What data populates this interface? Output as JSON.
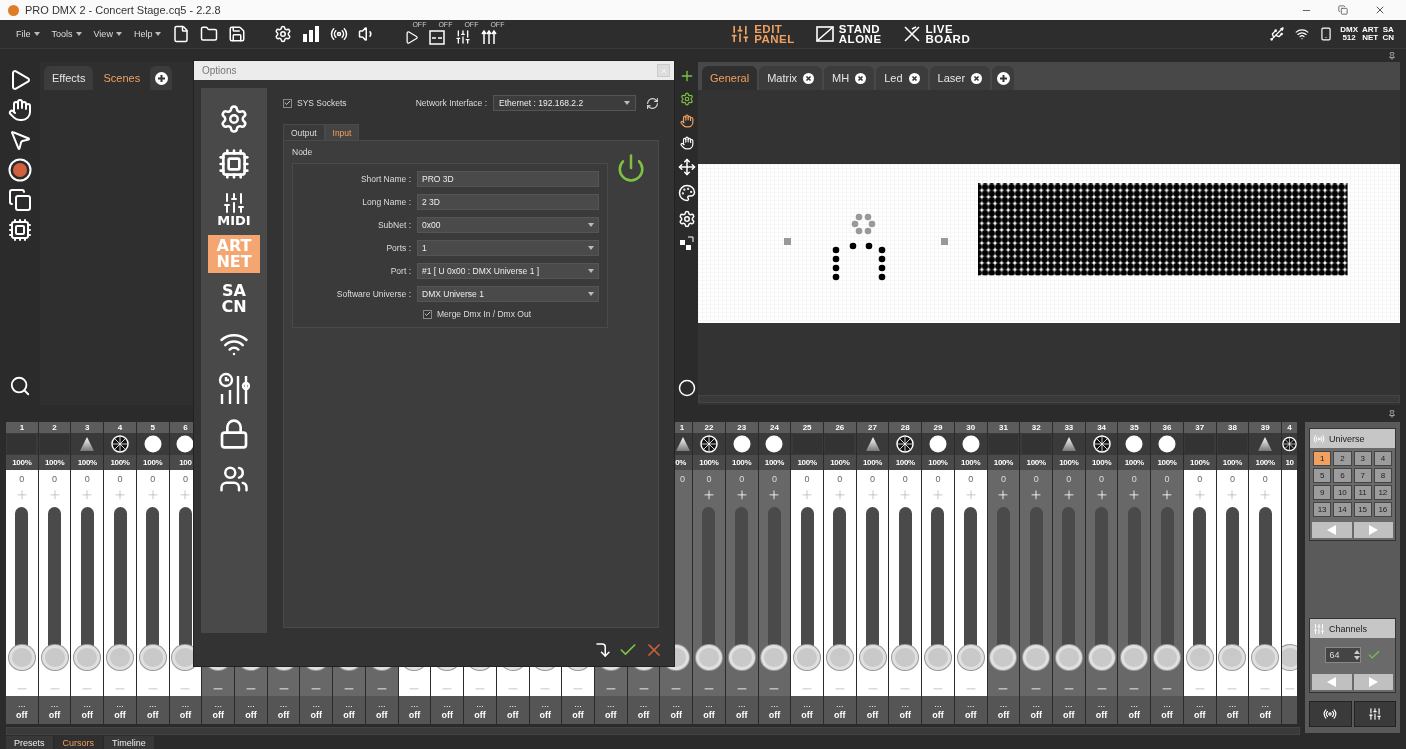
{
  "window": {
    "title": "PRO DMX 2 - Concert Stage.cq5 - 2.2.8"
  },
  "menu": [
    {
      "label": "File"
    },
    {
      "label": "Tools"
    },
    {
      "label": "View"
    },
    {
      "label": "Help"
    }
  ],
  "toolbar_toggles": [
    {
      "label": "OFF"
    },
    {
      "label": "OFF"
    },
    {
      "label": "OFF"
    },
    {
      "label": "OFF"
    }
  ],
  "modes": [
    {
      "label": "EDIT PANEL",
      "selected": true
    },
    {
      "label": "STAND ALONE",
      "selected": false
    },
    {
      "label": "LIVE BOARD",
      "selected": false
    }
  ],
  "protocols": [
    "DMX 512",
    "ART NET",
    "SA CN"
  ],
  "left_panel": {
    "tabs": [
      {
        "label": "Effects",
        "selected": false
      },
      {
        "label": "Scenes",
        "selected": true
      }
    ]
  },
  "stage": {
    "tabs": [
      {
        "label": "General",
        "selected": true,
        "closable": false
      },
      {
        "label": "Matrix",
        "selected": false,
        "closable": true
      },
      {
        "label": "MH",
        "selected": false,
        "closable": true
      },
      {
        "label": "Led",
        "selected": false,
        "closable": true
      },
      {
        "label": "Laser",
        "selected": false,
        "closable": true
      }
    ]
  },
  "channels": [
    {
      "number": "1",
      "kind": "blank",
      "percent": "100%",
      "value": "0",
      "dots": "...",
      "state": "off",
      "color": "#ffffff"
    },
    {
      "number": "2",
      "kind": "blank",
      "percent": "100%",
      "value": "0",
      "dots": "...",
      "state": "off",
      "color": "#ffffff"
    },
    {
      "number": "3",
      "kind": "beam",
      "percent": "100%",
      "value": "0",
      "dots": "...",
      "state": "off",
      "color": "#ffffff"
    },
    {
      "number": "4",
      "kind": "gobo",
      "percent": "100%",
      "value": "0",
      "dots": "...",
      "state": "off",
      "color": "#ffffff"
    },
    {
      "number": "5",
      "kind": "dot",
      "percent": "100%",
      "value": "0",
      "dots": "...",
      "state": "off",
      "color": "#ffffff"
    },
    {
      "number": "6",
      "kind": "dot",
      "percent": "100",
      "value": "0",
      "dots": "...",
      "state": "off",
      "color": "#ffffff"
    },
    {
      "dots": "...",
      "state": "off",
      "color": "#686868"
    },
    {
      "dots": "...",
      "state": "off",
      "color": "#686868"
    },
    {
      "dots": "...",
      "state": "off",
      "color": "#686868"
    },
    {
      "dots": "...",
      "state": "off",
      "color": "#686868"
    },
    {
      "dots": "...",
      "state": "off",
      "color": "#686868"
    },
    {
      "dots": "...",
      "state": "off",
      "color": "#686868"
    },
    {
      "dots": "...",
      "state": "off",
      "color": "#ffffff"
    },
    {
      "dots": "...",
      "state": "off",
      "color": "#ffffff"
    },
    {
      "dots": "...",
      "state": "off",
      "color": "#ffffff"
    },
    {
      "dots": "...",
      "state": "off",
      "color": "#ffffff"
    },
    {
      "dots": "...",
      "state": "off",
      "color": "#ffffff"
    },
    {
      "dots": "...",
      "state": "off",
      "color": "#ffffff"
    },
    {
      "dots": "...",
      "state": "off",
      "color": "#686868"
    },
    {
      "dots": "...",
      "state": "off",
      "color": "#686868"
    },
    {
      "number": "1",
      "kind": "beam",
      "percent": "0%",
      "value": "0",
      "dots": "...",
      "state": "off",
      "color": "#686868"
    },
    {
      "number": "22",
      "kind": "gobo",
      "percent": "100%",
      "value": "0",
      "dots": "...",
      "state": "off",
      "color": "#686868"
    },
    {
      "number": "23",
      "kind": "dot",
      "percent": "100%",
      "value": "0",
      "dots": "...",
      "state": "off",
      "color": "#686868"
    },
    {
      "number": "24",
      "kind": "dot",
      "percent": "100%",
      "value": "0",
      "dots": "...",
      "state": "off",
      "color": "#686868"
    },
    {
      "number": "25",
      "kind": "blank",
      "percent": "100%",
      "value": "0",
      "dots": "...",
      "state": "off",
      "color": "#ffffff"
    },
    {
      "number": "26",
      "kind": "blank",
      "percent": "100%",
      "value": "0",
      "dots": "...",
      "state": "off",
      "color": "#ffffff"
    },
    {
      "number": "27",
      "kind": "beam",
      "percent": "100%",
      "value": "0",
      "dots": "...",
      "state": "off",
      "color": "#ffffff"
    },
    {
      "number": "28",
      "kind": "gobo",
      "percent": "100%",
      "value": "0",
      "dots": "...",
      "state": "off",
      "color": "#ffffff"
    },
    {
      "number": "29",
      "kind": "dot",
      "percent": "100%",
      "value": "0",
      "dots": "...",
      "state": "off",
      "color": "#ffffff"
    },
    {
      "number": "30",
      "kind": "dot",
      "percent": "100%",
      "value": "0",
      "dots": "...",
      "state": "off",
      "color": "#ffffff"
    },
    {
      "number": "31",
      "kind": "blank",
      "percent": "100%",
      "value": "0",
      "dots": "...",
      "state": "off",
      "color": "#686868"
    },
    {
      "number": "32",
      "kind": "blank",
      "percent": "100%",
      "value": "0",
      "dots": "...",
      "state": "off",
      "color": "#686868"
    },
    {
      "number": "33",
      "kind": "beam",
      "percent": "100%",
      "value": "0",
      "dots": "...",
      "state": "off",
      "color": "#686868"
    },
    {
      "number": "34",
      "kind": "gobo",
      "percent": "100%",
      "value": "0",
      "dots": "...",
      "state": "off",
      "color": "#686868"
    },
    {
      "number": "35",
      "kind": "dot",
      "percent": "100%",
      "value": "0",
      "dots": "...",
      "state": "off",
      "color": "#686868"
    },
    {
      "number": "36",
      "kind": "dot",
      "percent": "100%",
      "value": "0",
      "dots": "...",
      "state": "off",
      "color": "#686868"
    },
    {
      "number": "37",
      "kind": "blank",
      "percent": "100%",
      "value": "0",
      "dots": "...",
      "state": "off",
      "color": "#ffffff"
    },
    {
      "number": "38",
      "kind": "blank",
      "percent": "100%",
      "value": "0",
      "dots": "...",
      "state": "off",
      "color": "#ffffff"
    },
    {
      "number": "39",
      "kind": "beam",
      "percent": "100%",
      "value": "0",
      "dots": "...",
      "state": "off",
      "color": "#ffffff"
    },
    {
      "number": "4",
      "kind": "gobo",
      "percent": "10",
      "color": "#ffffff"
    }
  ],
  "universe_panel": {
    "title": "Universe",
    "universes": [
      {
        "label": "1",
        "selected": true
      },
      {
        "label": "2",
        "selected": false
      },
      {
        "label": "3",
        "selected": false
      },
      {
        "label": "4",
        "selected": false
      },
      {
        "label": "5",
        "selected": false
      },
      {
        "label": "6",
        "selected": false
      },
      {
        "label": "7",
        "selected": false
      },
      {
        "label": "8",
        "selected": false
      },
      {
        "label": "9",
        "selected": false
      },
      {
        "label": "10",
        "selected": false
      },
      {
        "label": "11",
        "selected": false
      },
      {
        "label": "12",
        "selected": false
      },
      {
        "label": "13",
        "selected": false
      },
      {
        "label": "14",
        "selected": false
      },
      {
        "label": "15",
        "selected": false
      },
      {
        "label": "16",
        "selected": false
      }
    ]
  },
  "channels_panel": {
    "title": "Channels",
    "count": "64"
  },
  "bottom_tabs": [
    {
      "label": "Presets",
      "selected": false
    },
    {
      "label": "Cursors",
      "selected": true
    },
    {
      "label": "Timeline",
      "selected": false
    }
  ],
  "options_dialog": {
    "title": "Options",
    "sidebar": [
      {
        "kind": "gears",
        "selected": false
      },
      {
        "kind": "chip",
        "selected": false
      },
      {
        "kind": "midi",
        "label": "MIDI",
        "selected": false
      },
      {
        "kind": "text",
        "label": "ART NET",
        "selected": true
      },
      {
        "kind": "text",
        "label": "SA CN",
        "selected": false
      },
      {
        "kind": "network",
        "selected": false
      },
      {
        "kind": "timer",
        "selected": false
      },
      {
        "kind": "lock",
        "selected": false
      },
      {
        "kind": "users",
        "selected": false
      }
    ],
    "sys_sockets": {
      "label": "SYS Sockets",
      "checked": true
    },
    "network_interface": {
      "label": "Network Interface :",
      "value": "Ethernet : 192.168.2.2"
    },
    "tabs": [
      {
        "label": "Output",
        "selected": false
      },
      {
        "label": "Input",
        "selected": true
      }
    ],
    "group_title": "Node",
    "node_on": true,
    "fields": [
      {
        "label": "Short Name :",
        "value": "PRO 3D",
        "kind": "text"
      },
      {
        "label": "Long Name :",
        "value": "2 3D",
        "kind": "text"
      },
      {
        "label": "SubNet :",
        "value": "0x00",
        "kind": "select"
      },
      {
        "label": "Ports :",
        "value": "1",
        "kind": "select"
      },
      {
        "label": "Port :",
        "value": "#1 [ U 0x00 : DMX Universe 1 ]",
        "kind": "select"
      },
      {
        "label": "Software Universe :",
        "value": "DMX Universe 1",
        "kind": "select"
      }
    ],
    "merge": {
      "label": "Merge Dmx In / Dmx Out",
      "checked": true
    }
  }
}
